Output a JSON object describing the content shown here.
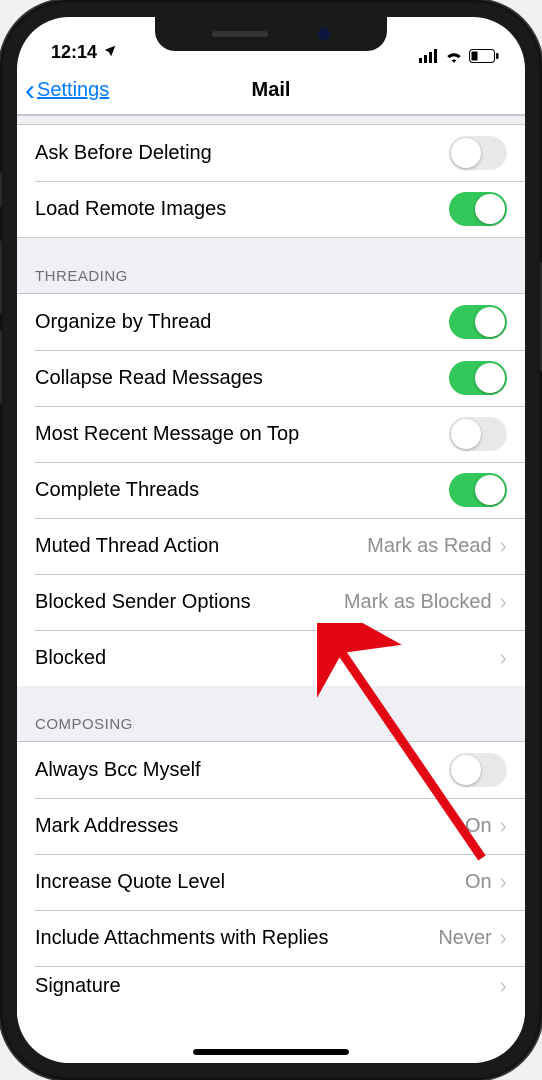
{
  "status": {
    "time": "12:14"
  },
  "nav": {
    "back": "Settings",
    "title": "Mail"
  },
  "sections": {
    "top": {
      "ask_before_deleting": {
        "label": "Ask Before Deleting",
        "on": false
      },
      "load_remote_images": {
        "label": "Load Remote Images",
        "on": true
      }
    },
    "threading": {
      "header": "THREADING",
      "organize_by_thread": {
        "label": "Organize by Thread",
        "on": true
      },
      "collapse_read": {
        "label": "Collapse Read Messages",
        "on": true
      },
      "most_recent_on_top": {
        "label": "Most Recent Message on Top",
        "on": false
      },
      "complete_threads": {
        "label": "Complete Threads",
        "on": true
      },
      "muted_action": {
        "label": "Muted Thread Action",
        "value": "Mark as Read"
      },
      "blocked_sender": {
        "label": "Blocked Sender Options",
        "value": "Mark as Blocked"
      },
      "blocked": {
        "label": "Blocked"
      }
    },
    "composing": {
      "header": "COMPOSING",
      "always_bcc": {
        "label": "Always Bcc Myself",
        "on": false
      },
      "mark_addresses": {
        "label": "Mark Addresses",
        "value": "On"
      },
      "increase_quote": {
        "label": "Increase Quote Level",
        "value": "On"
      },
      "include_attach": {
        "label": "Include Attachments with Replies",
        "value": "Never"
      },
      "signature": {
        "label": "Signature"
      }
    }
  },
  "annotation": {
    "type": "red-arrow",
    "points_to": "blocked_sender"
  }
}
